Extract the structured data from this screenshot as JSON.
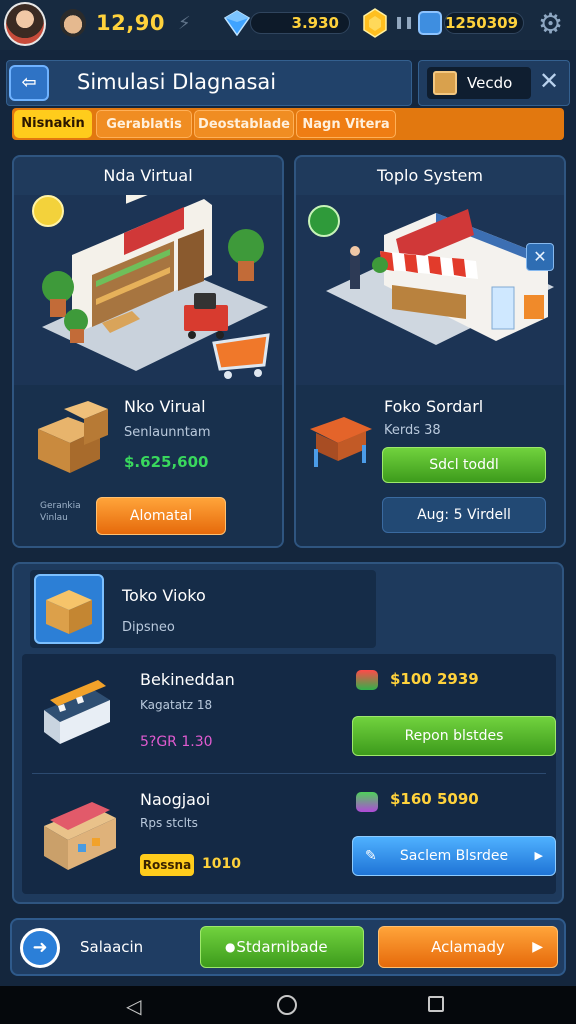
{
  "status": {
    "coins": "12,90",
    "gems": "3.930",
    "gold": "1250309"
  },
  "header": {
    "title": "Simulasi Dlagnasai",
    "side_label": "Vecdo"
  },
  "tabs": [
    {
      "label": "Nisnakin",
      "active": true
    },
    {
      "label": "Gerablatis",
      "active": false
    },
    {
      "label": "Deostablade",
      "active": false
    },
    {
      "label": "Nagn Vitera",
      "active": false
    }
  ],
  "stores": {
    "left": {
      "heading": "Nda Virtual",
      "name": "Nko Virual",
      "subtitle": "Senlaunntam",
      "price": "$.625,600",
      "tiny_label": [
        "Gerankia",
        "Vinlau"
      ],
      "button": "Alomatal"
    },
    "right": {
      "heading": "Toplo System",
      "name": "Foko Sordarl",
      "subtitle": "Kerds 38",
      "primary_button": "Sdcl toddl",
      "secondary_button": "Aug: 5 Virdell"
    }
  },
  "package": {
    "title": "Toko Vioko",
    "subtitle": "Dipsneo",
    "items": [
      {
        "name": "Bekineddan",
        "subtitle": "Kagatatz 18",
        "meta": "5?GR 1.30",
        "price": "$100 2939",
        "button": "Repon blstdes"
      },
      {
        "name": "Naogjaoi",
        "subtitle": "Rps stclts",
        "tag": "Rossna",
        "tag_value": "1010",
        "price": "$160 5090",
        "button": "Saclem Blsrdee"
      }
    ]
  },
  "actionbar": {
    "label": "Salaacin",
    "primary": "Stdarnibade",
    "secondary": "Aclamady"
  },
  "colors": {
    "background": "#14263d",
    "accent_orange": "#e2780f",
    "accent_green": "#4fb02a",
    "accent_blue": "#2b7fd8",
    "gold": "#ffd23c"
  }
}
